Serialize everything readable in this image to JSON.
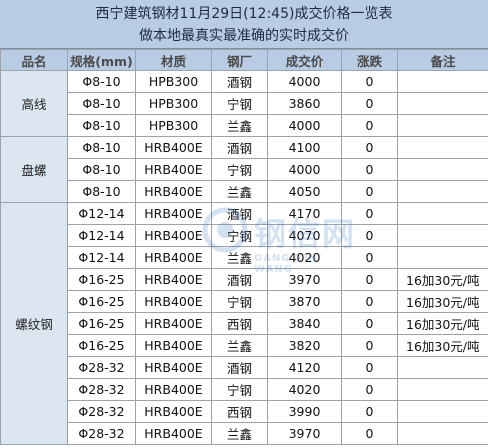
{
  "title": {
    "line1": "西宁建筑钢材11月29日(12:45)成交价格一览表",
    "line2": "做本地最真实最准确的实时成交价"
  },
  "headers": [
    "品名",
    "规格(mm)",
    "材质",
    "钢厂",
    "成交价",
    "涨跌",
    "备注"
  ],
  "groups": [
    {
      "product": "高线",
      "rows": [
        {
          "spec": "Φ8-10",
          "grade": "HPB300",
          "mill": "酒钢",
          "price": "4000",
          "change": "0",
          "remark": ""
        },
        {
          "spec": "Φ8-10",
          "grade": "HPB300",
          "mill": "宁钢",
          "price": "3860",
          "change": "0",
          "remark": ""
        },
        {
          "spec": "Φ8-10",
          "grade": "HPB300",
          "mill": "兰鑫",
          "price": "4000",
          "change": "0",
          "remark": ""
        }
      ]
    },
    {
      "product": "盘螺",
      "rows": [
        {
          "spec": "Φ8-10",
          "grade": "HRB400E",
          "mill": "酒钢",
          "price": "4100",
          "change": "0",
          "remark": ""
        },
        {
          "spec": "Φ8-10",
          "grade": "HRB400E",
          "mill": "宁钢",
          "price": "4000",
          "change": "0",
          "remark": ""
        },
        {
          "spec": "Φ8-10",
          "grade": "HRB400E",
          "mill": "兰鑫",
          "price": "4050",
          "change": "0",
          "remark": ""
        }
      ]
    },
    {
      "product": "螺纹钢",
      "rows": [
        {
          "spec": "Φ12-14",
          "grade": "HRB400E",
          "mill": "酒钢",
          "price": "4170",
          "change": "0",
          "remark": ""
        },
        {
          "spec": "Φ12-14",
          "grade": "HRB400E",
          "mill": "宁钢",
          "price": "4070",
          "change": "0",
          "remark": ""
        },
        {
          "spec": "Φ12-14",
          "grade": "HRB400E",
          "mill": "兰鑫",
          "price": "4020",
          "change": "0",
          "remark": ""
        },
        {
          "spec": "Φ16-25",
          "grade": "HRB400E",
          "mill": "酒钢",
          "price": "3970",
          "change": "0",
          "remark": "16加30元/吨"
        },
        {
          "spec": "Φ16-25",
          "grade": "HRB400E",
          "mill": "宁钢",
          "price": "3870",
          "change": "0",
          "remark": "16加30元/吨"
        },
        {
          "spec": "Φ16-25",
          "grade": "HRB400E",
          "mill": "西钢",
          "price": "3840",
          "change": "0",
          "remark": "16加30元/吨"
        },
        {
          "spec": "Φ16-25",
          "grade": "HRB400E",
          "mill": "兰鑫",
          "price": "3820",
          "change": "0",
          "remark": "16加30元/吨"
        },
        {
          "spec": "Φ28-32",
          "grade": "HRB400E",
          "mill": "酒钢",
          "price": "4120",
          "change": "0",
          "remark": ""
        },
        {
          "spec": "Φ28-32",
          "grade": "HRB400E",
          "mill": "宁钢",
          "price": "4020",
          "change": "0",
          "remark": ""
        },
        {
          "spec": "Φ28-32",
          "grade": "HRB400E",
          "mill": "西钢",
          "price": "3990",
          "change": "0",
          "remark": ""
        },
        {
          "spec": "Φ28-32",
          "grade": "HRB400E",
          "mill": "兰鑫",
          "price": "3970",
          "change": "0",
          "remark": ""
        }
      ]
    }
  ],
  "watermark": {
    "text": "钢信网",
    "subtext": "GANG XIN WANG"
  },
  "colors": {
    "header_bg": "#b8cce4",
    "product_bg": "#dce6f1",
    "border": "#9aa3ad"
  }
}
